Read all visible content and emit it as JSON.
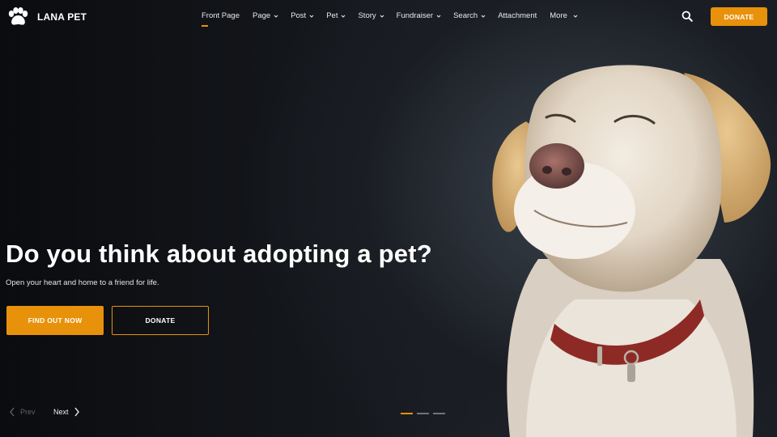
{
  "brand": {
    "name": "LANA PET",
    "accent": "#e8910b"
  },
  "nav": {
    "items": [
      {
        "label": "Front Page",
        "has_dropdown": false,
        "active": true
      },
      {
        "label": "Page",
        "has_dropdown": true
      },
      {
        "label": "Post",
        "has_dropdown": true
      },
      {
        "label": "Pet",
        "has_dropdown": true
      },
      {
        "label": "Story",
        "has_dropdown": true
      },
      {
        "label": "Fundraiser",
        "has_dropdown": true
      },
      {
        "label": "Search",
        "has_dropdown": true
      },
      {
        "label": "Attachment",
        "has_dropdown": false
      },
      {
        "label": "More",
        "has_dropdown": true
      }
    ],
    "search_icon": "search-icon",
    "donate_label": "DONATE"
  },
  "hero": {
    "headline": "Do you think about adopting a pet?",
    "subline": "Open your heart and home to a friend for life.",
    "primary_button": "FIND OUT NOW",
    "secondary_button": "DONATE",
    "image": "labrador-dog-photo"
  },
  "slider": {
    "prev_label": "Prev",
    "next_label": "Next",
    "slides": 3,
    "active_slide": 1
  }
}
